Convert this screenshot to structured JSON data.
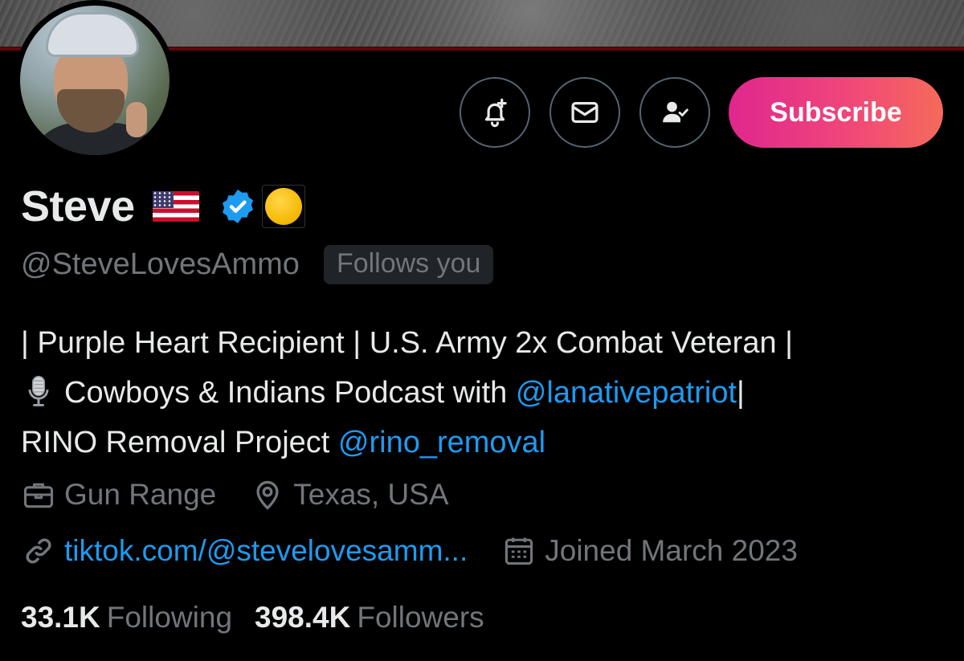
{
  "profile": {
    "name": "Steve",
    "handle": "@SteveLovesAmmo",
    "follows_you": "Follows you",
    "flag_emoji": "us-flag",
    "verified_badge": "verified-icon",
    "affiliation_badge": "yellow-circle-icon"
  },
  "actions": {
    "subscribe_label": "Subscribe",
    "notify_icon": "bell-plus-icon",
    "message_icon": "envelope-icon",
    "following_icon": "person-check-icon"
  },
  "bio": {
    "line1": "| Purple Heart Recipient | U.S. Army 2x Combat Veteran |",
    "line2_text": "Cowboys & Indians Podcast with ",
    "line2_mention": "@lanativepatriot",
    "line2_tail": "|",
    "line3_text": "RINO Removal Project ",
    "line3_mention": "@rino_removal"
  },
  "meta": {
    "category": "Gun Range",
    "location": "Texas, USA",
    "website": "tiktok.com/@stevelovesamm...",
    "joined": "Joined March 2023"
  },
  "stats": {
    "following_count": "33.1K",
    "following_label": "Following",
    "followers_count": "398.4K",
    "followers_label": "Followers"
  },
  "colors": {
    "link": "#1d9bf0",
    "muted": "#71767b",
    "text": "#e7e9ea",
    "subscribe_gradient_start": "#e0268e",
    "subscribe_gradient_end": "#f56a5a"
  }
}
